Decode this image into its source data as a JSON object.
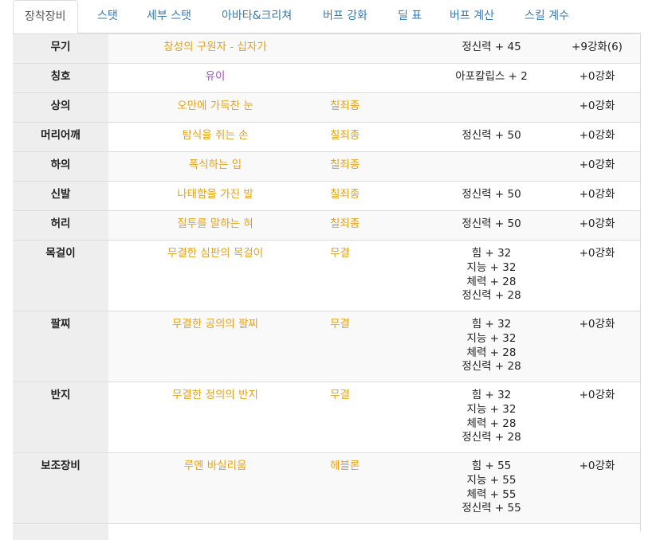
{
  "tabs": [
    {
      "label": "장착장비",
      "active": true
    },
    {
      "label": "스탯",
      "active": false
    },
    {
      "label": "세부 스탯",
      "active": false
    },
    {
      "label": "아바타&크리쳐",
      "active": false
    },
    {
      "label": "버프 강화",
      "active": false
    },
    {
      "label": "딜 표",
      "active": false
    },
    {
      "label": "버프 계산",
      "active": false
    },
    {
      "label": "스킬 계수",
      "active": false
    }
  ],
  "colors": {
    "item_gold": "#e8a117",
    "item_purple": "#9b51c7",
    "tab_link": "#337ab7"
  },
  "rows": [
    {
      "slot": "무기",
      "item": "창성의 구원자 - 십자가",
      "set": "",
      "stats": [
        "정신력 + 45"
      ],
      "enhance": "+9강화(6)"
    },
    {
      "slot": "칭호",
      "item": "유이",
      "set": "",
      "stats": [
        "아포칼립스 + 2"
      ],
      "enhance": "+0강화"
    },
    {
      "slot": "상의",
      "item": "오만에 가득찬 눈",
      "set": "칠죄종",
      "stats": [],
      "enhance": "+0강화"
    },
    {
      "slot": "머리어깨",
      "item": "탐식을 쥐는 손",
      "set": "칠죄종",
      "stats": [
        "정신력 + 50"
      ],
      "enhance": "+0강화"
    },
    {
      "slot": "하의",
      "item": "폭식하는 입",
      "set": "칠죄종",
      "stats": [],
      "enhance": "+0강화"
    },
    {
      "slot": "신발",
      "item": "나태함을 가진 발",
      "set": "칠죄종",
      "stats": [
        "정신력 + 50"
      ],
      "enhance": "+0강화"
    },
    {
      "slot": "허리",
      "item": "질투를 말하는 혀",
      "set": "칠죄종",
      "stats": [
        "정신력 + 50"
      ],
      "enhance": "+0강화"
    },
    {
      "slot": "목걸이",
      "item": "무결한 심판의 목걸이",
      "set": "무결",
      "stats": [
        "힘 + 32",
        "지능 + 32",
        "체력 + 28",
        "정신력 + 28"
      ],
      "enhance": "+0강화"
    },
    {
      "slot": "팔찌",
      "item": "무결한 공의의 팔찌",
      "set": "무결",
      "stats": [
        "힘 + 32",
        "지능 + 32",
        "체력 + 28",
        "정신력 + 28"
      ],
      "enhance": "+0강화"
    },
    {
      "slot": "반지",
      "item": "무결한 정의의 반지",
      "set": "무결",
      "stats": [
        "힘 + 32",
        "지능 + 32",
        "체력 + 28",
        "정신력 + 28"
      ],
      "enhance": "+0강화"
    },
    {
      "slot": "보조장비",
      "item": "루멘 바실리움",
      "set": "헤블론",
      "stats": [
        "힘 + 55",
        "지능 + 55",
        "체력 + 55",
        "정신력 + 55"
      ],
      "enhance": "+0강화"
    }
  ]
}
